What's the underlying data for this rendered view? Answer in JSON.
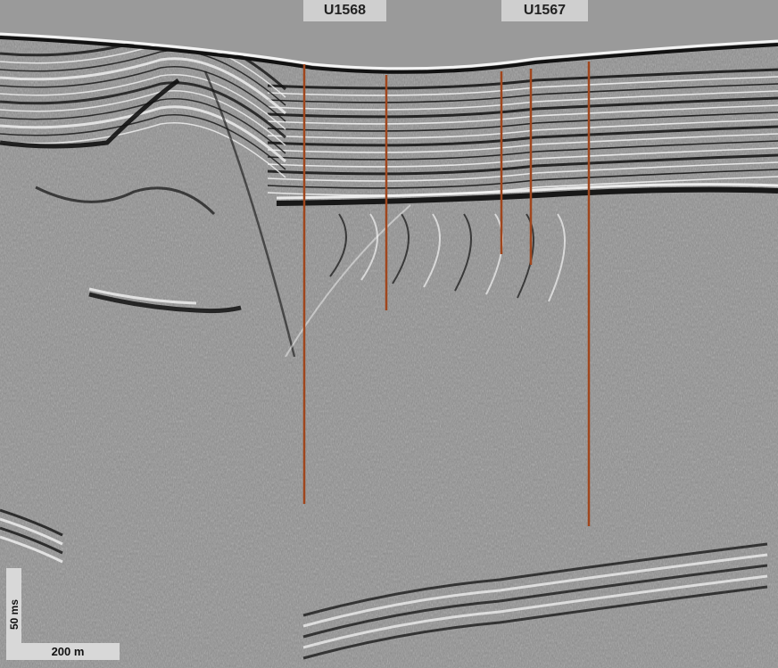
{
  "sites": [
    {
      "label": "U1568"
    },
    {
      "label": "U1567"
    }
  ],
  "scale": {
    "horizontal_label": "200 m",
    "vertical_label": "50 ms"
  },
  "colors": {
    "water": "#9a9a9a",
    "label_bg": "#cfcfcf",
    "borehole": "#a0461d",
    "reflector_dark": "#111111",
    "reflector_light": "#f4f4f4"
  }
}
